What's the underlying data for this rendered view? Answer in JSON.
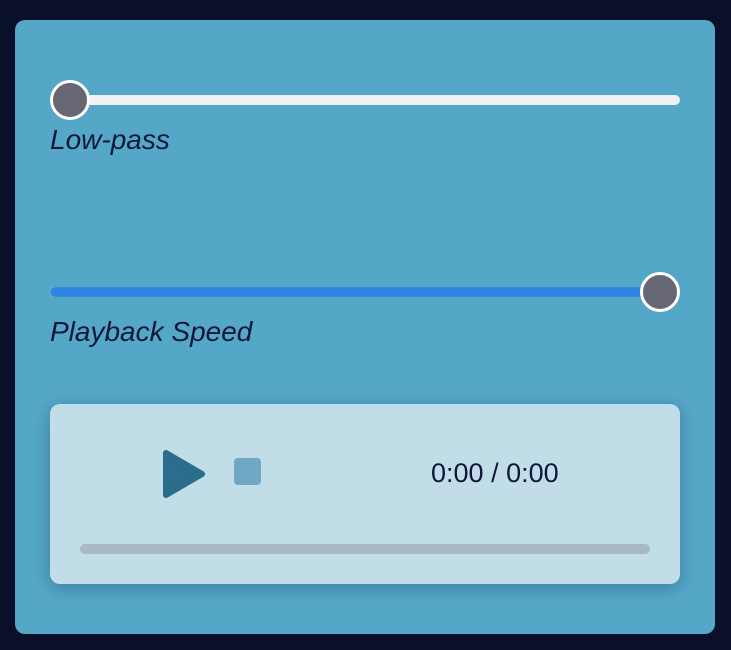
{
  "sliders": [
    {
      "label": "Low-pass",
      "value": 0.0
    },
    {
      "label": "Playback Speed",
      "value": 1.0
    }
  ],
  "player": {
    "current_time": "0:00",
    "separator": " / ",
    "duration": "0:00",
    "progress": 0.0,
    "play_icon": "play-icon",
    "stop_icon": "stop-icon"
  },
  "colors": {
    "background": "#0a0f2a",
    "panel": "#55a7c8",
    "accent": "#2f86e0",
    "player_bg": "#c1dee8",
    "play": "#2a6d8d"
  }
}
